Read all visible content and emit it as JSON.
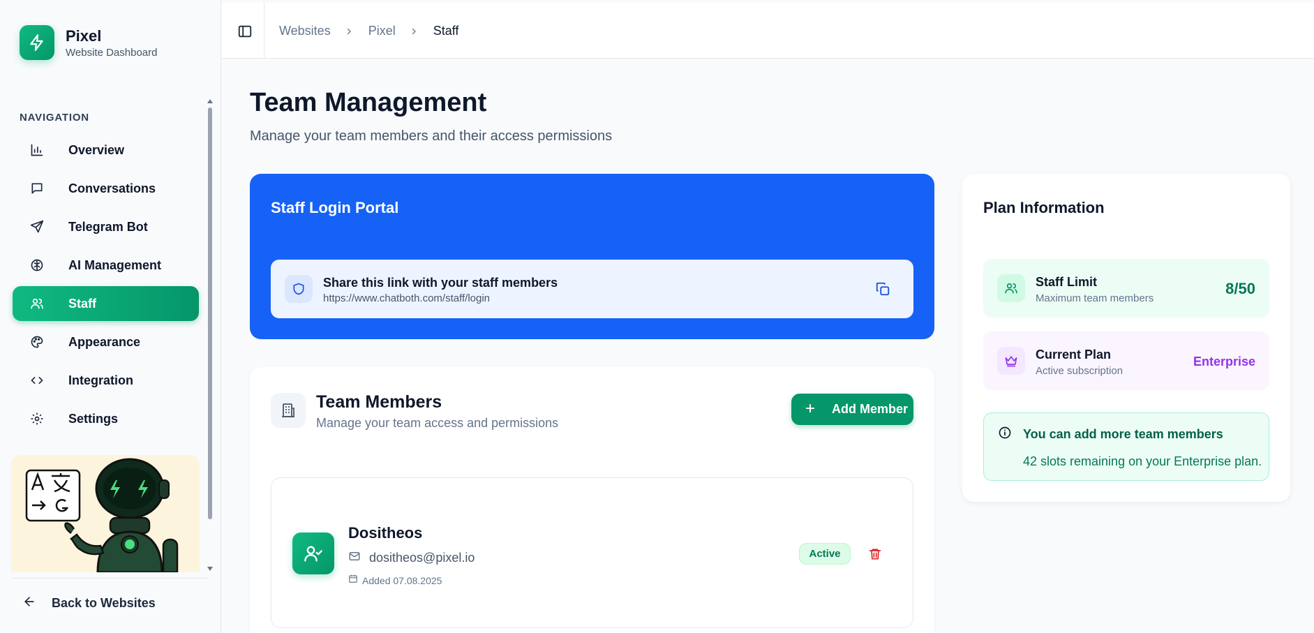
{
  "brand": {
    "name": "Pixel",
    "subtitle": "Website Dashboard"
  },
  "sidebar": {
    "heading": "NAVIGATION",
    "items": [
      {
        "label": "Overview",
        "icon": "bar-chart-icon"
      },
      {
        "label": "Conversations",
        "icon": "chat-bubble-icon"
      },
      {
        "label": "Telegram Bot",
        "icon": "send-icon"
      },
      {
        "label": "AI Management",
        "icon": "brain-icon"
      },
      {
        "label": "Staff",
        "icon": "users-icon",
        "active": true
      },
      {
        "label": "Appearance",
        "icon": "palette-icon"
      },
      {
        "label": "Integration",
        "icon": "code-icon"
      },
      {
        "label": "Settings",
        "icon": "gear-icon"
      }
    ],
    "back_label": "Back to Websites"
  },
  "breadcrumb": [
    "Websites",
    "Pixel",
    "Staff"
  ],
  "page": {
    "title": "Team Management",
    "subtitle": "Manage your team members and their access permissions"
  },
  "portal": {
    "title": "Staff Login Portal",
    "label": "Share this link with your staff members",
    "url": "https://www.chatboth.com/staff/login"
  },
  "members": {
    "title": "Team Members",
    "subtitle": "Manage your team access and permissions",
    "add_label": "Add Member",
    "list": [
      {
        "name": "Dositheos",
        "email": "dositheos@pixel.io",
        "added": "Added 07.08.2025",
        "status": "Active"
      }
    ]
  },
  "plan": {
    "title": "Plan Information",
    "staff_limit": {
      "label": "Staff Limit",
      "sub": "Maximum team members",
      "value": "8/50"
    },
    "current_plan": {
      "label": "Current Plan",
      "sub": "Active subscription",
      "value": "Enterprise"
    },
    "notice": {
      "title": "You can add more team members",
      "text": "42 slots remaining on your Enterprise plan."
    }
  },
  "colors": {
    "accent": "#059669",
    "portal_blue": "#1662f6",
    "enterprise_purple": "#9333ea"
  }
}
